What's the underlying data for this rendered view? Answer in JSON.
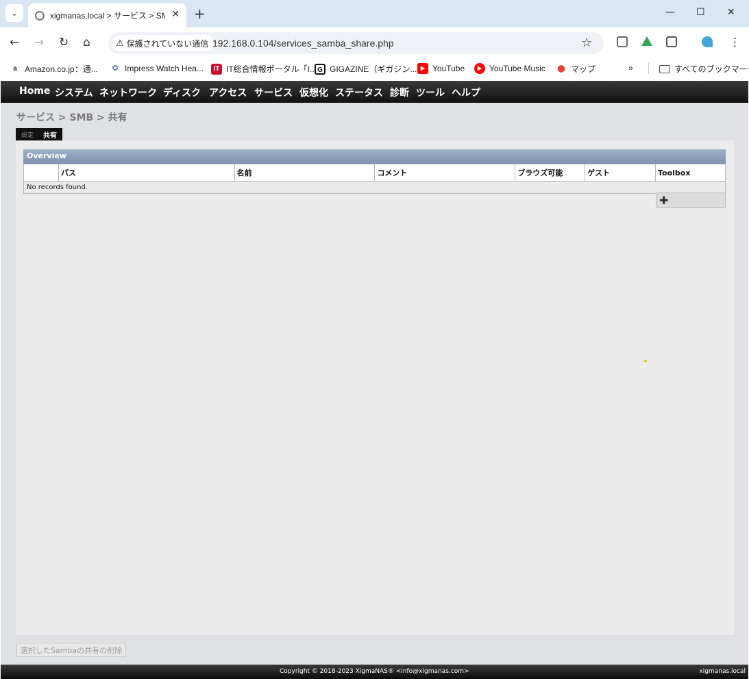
{
  "browser": {
    "tab_title": "xigmanas.local > サービス > SMB",
    "security_label": "保護されていない通信",
    "url": "192.168.0.104/services_samba_share.php",
    "bookmarks": [
      {
        "label": "Amazon.co.jp：通...",
        "icon": "amazon-icon"
      },
      {
        "label": "Impress Watch Hea...",
        "icon": "impress-icon"
      },
      {
        "label": "IT総合情報ポータル「I...",
        "icon": "itmedia-icon"
      },
      {
        "label": "GIGAZINE（ギガジン...",
        "icon": "gigazine-icon"
      },
      {
        "label": "YouTube",
        "icon": "youtube-icon"
      },
      {
        "label": "YouTube Music",
        "icon": "youtube-music-icon"
      },
      {
        "label": "マップ",
        "icon": "maps-icon"
      }
    ],
    "all_bookmarks": "すべてのブックマーク"
  },
  "nav": {
    "items": [
      "Home",
      "システム",
      "ネットワーク",
      "ディスク",
      "アクセス",
      "サービス",
      "仮想化",
      "ステータス",
      "診断",
      "ツール",
      "ヘルプ"
    ]
  },
  "breadcrumb": "サービス > SMB > 共有",
  "tabs": {
    "settings": "設定",
    "shares": "共有"
  },
  "overview": {
    "title": "Overview",
    "columns": [
      "",
      "パス",
      "名前",
      "コメント",
      "ブラウズ可能",
      "ゲスト",
      "Toolbox"
    ],
    "empty_message": "No records found."
  },
  "delete_button": "選択したSambaの共有の削除",
  "footer": {
    "copyright": "Copyright © 2018-2023 XigmaNAS® <info@xigmanas.com>",
    "hostname": "xigmanas.local"
  },
  "colors": {
    "nav_bg": "#111111",
    "content_bg": "#ececec",
    "page_bg": "#dfe1e5",
    "header_bar": "#8da2bd"
  }
}
